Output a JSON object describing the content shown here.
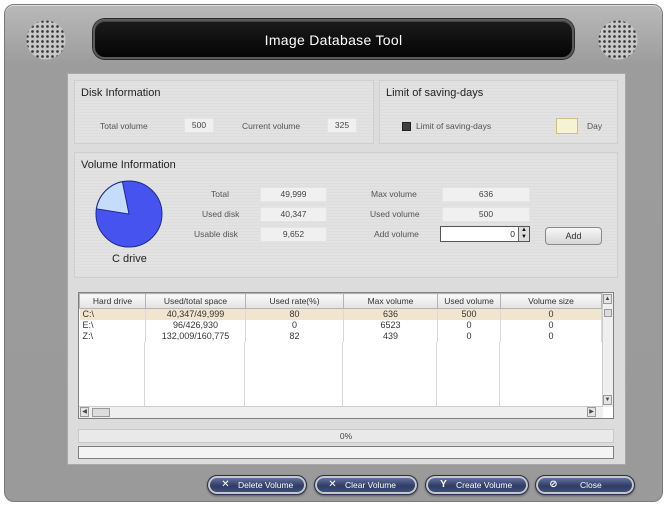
{
  "window": {
    "title": "Image Database Tool"
  },
  "disk_information": {
    "title": "Disk Information",
    "total_volume_label": "Total volume",
    "total_volume": "500",
    "current_volume_label": "Current volume",
    "current_volume": "325"
  },
  "saving_days": {
    "title": "Limit of saving-days",
    "checkbox_label": "Limit of saving-days",
    "day_value": "",
    "day_unit": "Day"
  },
  "volume_information": {
    "title": "Volume Information",
    "pie_caption": "C drive",
    "pie_used_fraction": 0.807,
    "pie_colors": {
      "used": "#4753ee",
      "free": "#c6dcfb"
    },
    "total_label": "Total",
    "total": "49,999",
    "used_disk_label": "Used disk",
    "used_disk": "40,347",
    "usable_disk_label": "Usable disk",
    "usable_disk": "9,652",
    "max_volume_label": "Max volume",
    "max_volume": "636",
    "used_volume_label": "Used volume",
    "used_volume": "500",
    "add_volume_label": "Add volume",
    "add_volume_value": "0",
    "add_button": "Add"
  },
  "table": {
    "columns": [
      "Hard drive",
      "Used/total space",
      "Used rate(%)",
      "Max volume",
      "Used volume",
      "Volume size"
    ],
    "rows": [
      [
        "C:\\",
        "40,347/49,999",
        "80",
        "636",
        "500",
        "0"
      ],
      [
        "E:\\",
        "96/426,930",
        "0",
        "6523",
        "0",
        "0"
      ],
      [
        "Z:\\",
        "132,009/160,775",
        "82",
        "439",
        "0",
        "0"
      ]
    ]
  },
  "progress": {
    "label": "0%",
    "value": 0
  },
  "buttons": {
    "delete_volume": "Delete Volume",
    "clear_volume": "Clear Volume",
    "create_volume": "Create Volume",
    "close": "Close"
  }
}
